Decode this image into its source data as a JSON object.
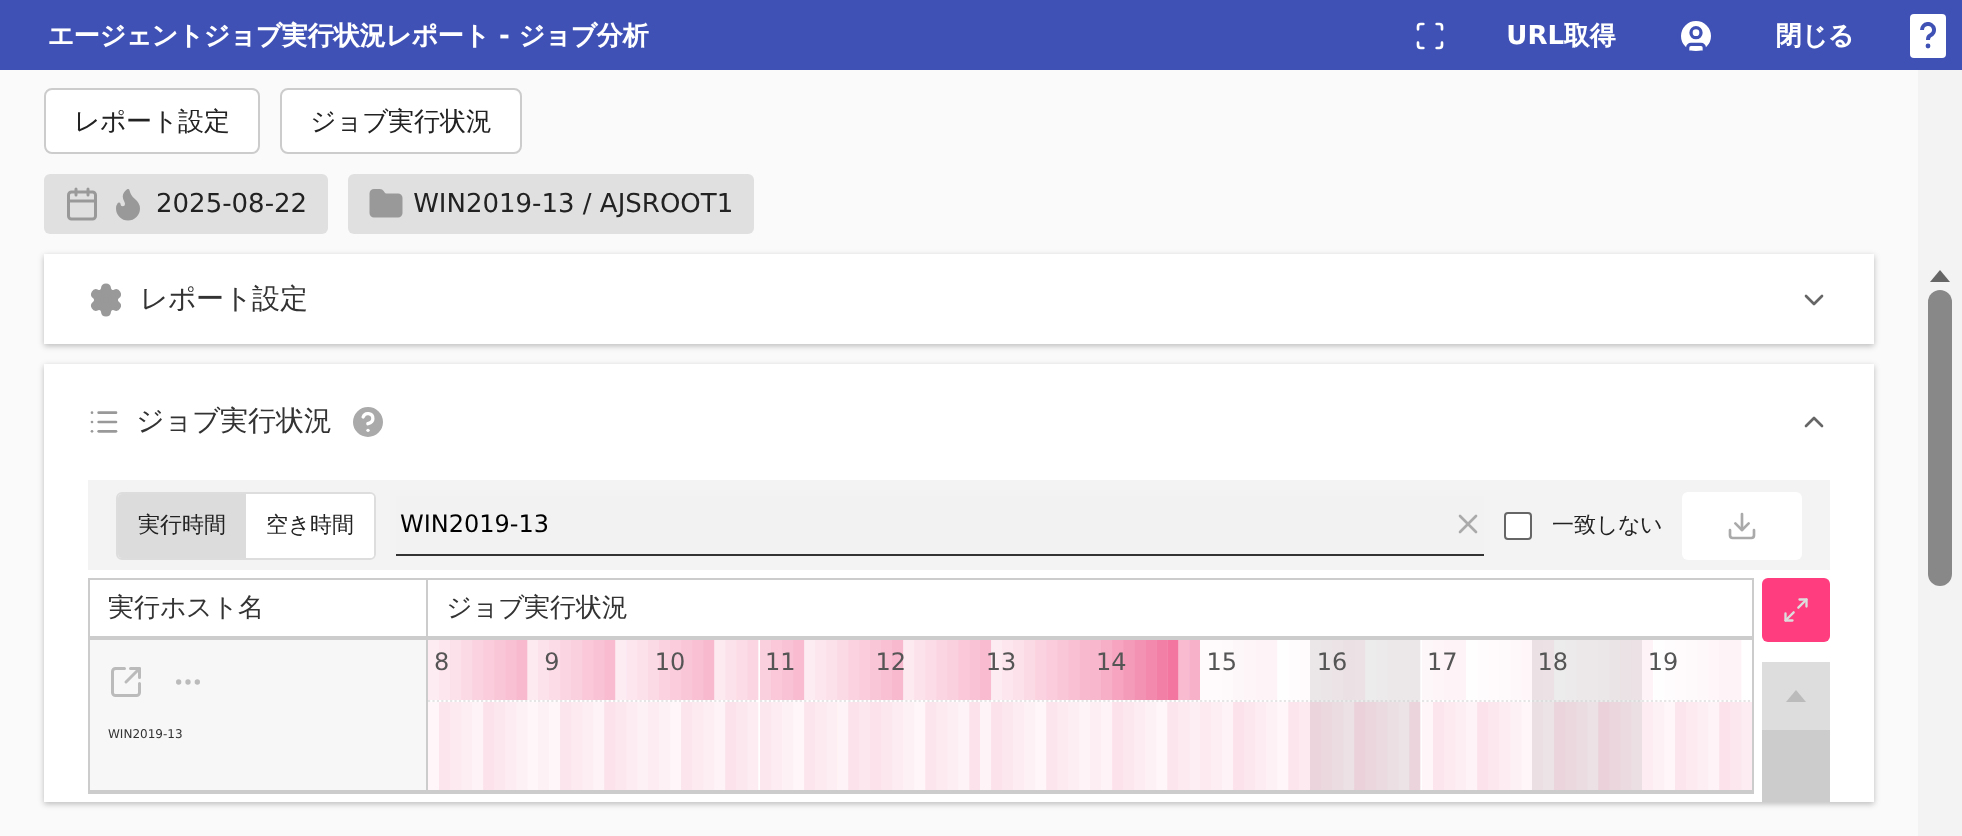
{
  "header": {
    "title": "エージェントジョブ実行状況レポート - ジョブ分析",
    "url_button": "URL取得",
    "close_button": "閉じる"
  },
  "nav_buttons": [
    "レポート設定",
    "ジョブ実行状況"
  ],
  "chips": [
    {
      "kind": "date",
      "label": "2025-08-22"
    },
    {
      "kind": "folder",
      "label": "WIN2019-13 / AJSROOT1"
    }
  ],
  "sections": [
    {
      "kind": "settings",
      "title": "レポート設定",
      "expanded": false
    },
    {
      "kind": "list",
      "title": "ジョブ実行状況",
      "expanded": true
    }
  ],
  "job_status": {
    "segments": [
      {
        "label": "実行時間",
        "selected": true
      },
      {
        "label": "空き時間",
        "selected": false
      }
    ],
    "filter": {
      "value": "WIN2019-13"
    },
    "exclude": {
      "label": "一致しない",
      "checked": false
    },
    "columns": [
      "実行ホスト名",
      "ジョブ実行状況"
    ],
    "rows": [
      {
        "host": "WIN2019-13"
      }
    ],
    "hours": [
      "8",
      "9",
      "10",
      "11",
      "12",
      "13",
      "14",
      "15",
      "16",
      "17",
      "18",
      "19"
    ]
  }
}
